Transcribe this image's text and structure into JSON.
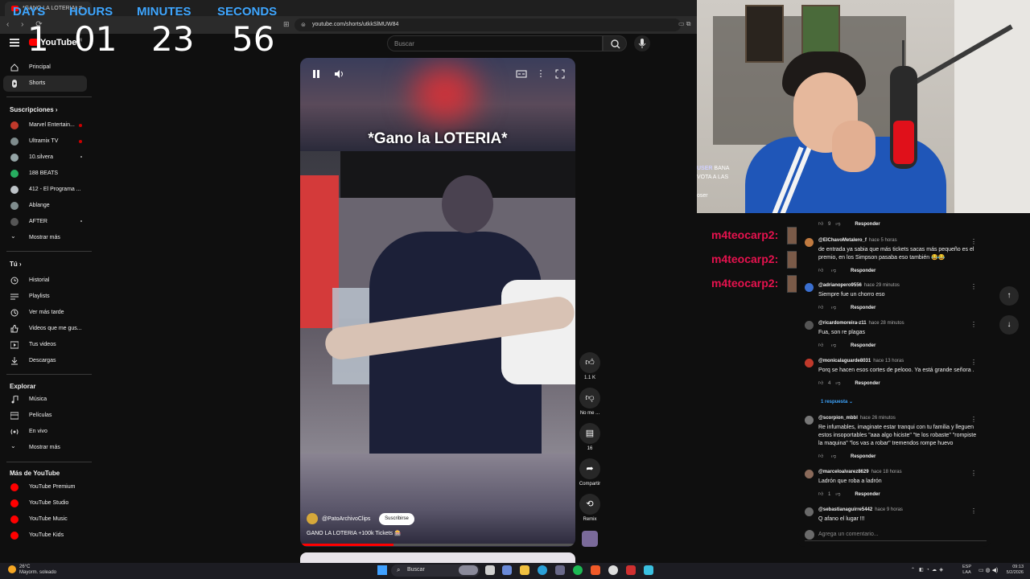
{
  "browser": {
    "tab_title": "*GANO LA LOTERIA* #...",
    "url": "youtube.com/shorts/utkkSlMUW84"
  },
  "countdown": {
    "labels": [
      "DAYS",
      "HOURS",
      "MINUTES",
      "SECONDS"
    ],
    "values": [
      "1",
      "01",
      "23",
      "56"
    ]
  },
  "masthead": {
    "logo": "YouTube",
    "country": "AR",
    "search_placeholder": "Buscar"
  },
  "sidebar": {
    "main": [
      {
        "label": "Principal",
        "icon": "home-icon"
      },
      {
        "label": "Shorts",
        "icon": "shorts-icon",
        "active": true
      }
    ],
    "subscriptions_heading": "Suscripciones",
    "subscriptions": [
      {
        "label": "Marvel Entertain...",
        "color": "#c0392b",
        "live": true
      },
      {
        "label": "Ultramix TV",
        "color": "#7f8c8d",
        "live": true
      },
      {
        "label": "10.silvera",
        "color": "#95a5a6",
        "dot": true
      },
      {
        "label": "188 BEATS",
        "color": "#27ae60"
      },
      {
        "label": "412 - El Programa ...",
        "color": "#bdc3c7"
      },
      {
        "label": "Ablange",
        "color": "#7f8c8d"
      },
      {
        "label": "AFTER",
        "color": "#555555",
        "dot": true
      },
      {
        "label": "Mostrar más",
        "icon": "chevron-down-icon"
      }
    ],
    "you_heading": "Tú",
    "you": [
      {
        "label": "Historial",
        "icon": "history-icon"
      },
      {
        "label": "Playlists",
        "icon": "playlist-icon"
      },
      {
        "label": "Ver más tarde",
        "icon": "clock-icon"
      },
      {
        "label": "Videos que me gus...",
        "icon": "thumbs-up-icon"
      },
      {
        "label": "Tus videos",
        "icon": "video-icon"
      },
      {
        "label": "Descargas",
        "icon": "download-icon"
      }
    ],
    "explore_heading": "Explorar",
    "explore": [
      {
        "label": "Música",
        "icon": "music-icon"
      },
      {
        "label": "Películas",
        "icon": "film-icon"
      },
      {
        "label": "En vivo",
        "icon": "live-icon"
      },
      {
        "label": "Mostrar más",
        "icon": "chevron-down-icon"
      }
    ],
    "more_heading": "Más de YouTube",
    "more": [
      {
        "label": "YouTube Premium"
      },
      {
        "label": "YouTube Studio"
      },
      {
        "label": "YouTube Music"
      },
      {
        "label": "YouTube Kids"
      }
    ]
  },
  "short": {
    "overlay_title": "*Gano la LOTERIA*",
    "channel": "@PatoArchivoClips",
    "subscribe_label": "Suscribirse",
    "description": "GANO LA LOTERIA +100k Tickets 🎰",
    "progress": 0.34
  },
  "actions": {
    "like_count": "1.1 K",
    "dislike_label": "No me ...",
    "comment_count": "16",
    "share_label": "Compartir",
    "remix_label": "Remix"
  },
  "stream_chat": {
    "line1_user": "USER",
    "line1_text": "BANA",
    "line2": "VOTA A LAS",
    "line3_user": "oser",
    "m4_name": "m4teocarp2:"
  },
  "comments": {
    "top_actions": {
      "likes": "9",
      "reply": "Responder"
    },
    "items": [
      {
        "user": "@ElChavoMetalero_f",
        "ago": "hace 5 horas",
        "text": "de entrada ya sabia que más tickets sacas más pequeño es el premio, en los Simpson pasaba eso también 😂😂",
        "likes": "",
        "reply": "Responder",
        "avatar_color": "#c07a40"
      },
      {
        "user": "@adrianopero9556",
        "ago": "hace 29 minutos",
        "text": "Siempre fue un chorro eso",
        "likes": "",
        "reply": "Responder",
        "avatar_color": "#3a6fd0"
      },
      {
        "user": "@ricardomoreira-z11",
        "ago": "hace 28 minutos",
        "text": "Fua, son re plagas",
        "likes": "",
        "reply": "Responder",
        "avatar_color": "#555555"
      },
      {
        "user": "@monicalaguarde8031",
        "ago": "hace 13 horas",
        "text": "Porq se hacen esos cortes de pelooo. Ya está grande señora .",
        "likes": "4",
        "reply": "Responder",
        "avatar_color": "#c0392b"
      },
      {
        "user": "@scorpion_mbbl",
        "ago": "hace 26 minutos",
        "text": "Re infumables, imaginate estar tranqui con tu familia y lleguen estos insoportables \"aaa algo hiciste\" \"te los robaste\" \"rompiste la maquina\" \"los vas a robar\" tremendos rompe huevo",
        "likes": "",
        "reply": "Responder",
        "avatar_color": "#777777"
      },
      {
        "user": "@marceloalvarez8629",
        "ago": "hace 18 horas",
        "text": "Ladrón que roba a ladrón",
        "likes": "1",
        "reply": "Responder",
        "avatar_color": "#8a6a5a"
      },
      {
        "user": "@sebastianaguirre5442",
        "ago": "hace 9 horas",
        "text": "Q afano el lugar !!!",
        "likes": "",
        "reply": "",
        "avatar_color": "#6a6a6a"
      }
    ],
    "replies_toggle": "1 respuesta",
    "add_placeholder": "Agrega un comentario..."
  },
  "taskbar": {
    "temp": "26°C",
    "weather": "Mayorm. soleado",
    "search": "Buscar",
    "lang1": "ESP",
    "lang2": "LAA",
    "time": "09:13",
    "date": "5/2/2026"
  }
}
